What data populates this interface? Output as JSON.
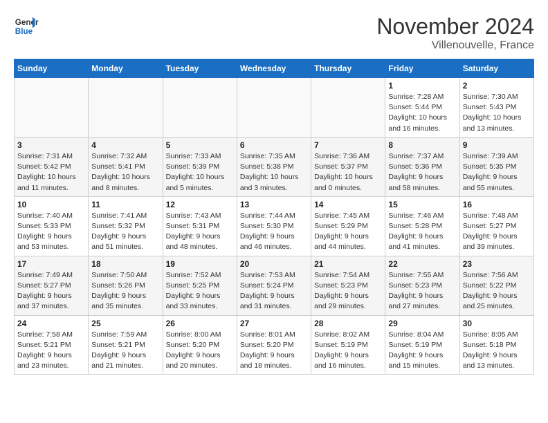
{
  "header": {
    "logo_line1": "General",
    "logo_line2": "Blue",
    "month": "November 2024",
    "location": "Villenouvelle, France"
  },
  "weekdays": [
    "Sunday",
    "Monday",
    "Tuesday",
    "Wednesday",
    "Thursday",
    "Friday",
    "Saturday"
  ],
  "weeks": [
    [
      {
        "day": "",
        "info": ""
      },
      {
        "day": "",
        "info": ""
      },
      {
        "day": "",
        "info": ""
      },
      {
        "day": "",
        "info": ""
      },
      {
        "day": "",
        "info": ""
      },
      {
        "day": "1",
        "info": "Sunrise: 7:28 AM\nSunset: 5:44 PM\nDaylight: 10 hours and 16 minutes."
      },
      {
        "day": "2",
        "info": "Sunrise: 7:30 AM\nSunset: 5:43 PM\nDaylight: 10 hours and 13 minutes."
      }
    ],
    [
      {
        "day": "3",
        "info": "Sunrise: 7:31 AM\nSunset: 5:42 PM\nDaylight: 10 hours and 11 minutes."
      },
      {
        "day": "4",
        "info": "Sunrise: 7:32 AM\nSunset: 5:41 PM\nDaylight: 10 hours and 8 minutes."
      },
      {
        "day": "5",
        "info": "Sunrise: 7:33 AM\nSunset: 5:39 PM\nDaylight: 10 hours and 5 minutes."
      },
      {
        "day": "6",
        "info": "Sunrise: 7:35 AM\nSunset: 5:38 PM\nDaylight: 10 hours and 3 minutes."
      },
      {
        "day": "7",
        "info": "Sunrise: 7:36 AM\nSunset: 5:37 PM\nDaylight: 10 hours and 0 minutes."
      },
      {
        "day": "8",
        "info": "Sunrise: 7:37 AM\nSunset: 5:36 PM\nDaylight: 9 hours and 58 minutes."
      },
      {
        "day": "9",
        "info": "Sunrise: 7:39 AM\nSunset: 5:35 PM\nDaylight: 9 hours and 55 minutes."
      }
    ],
    [
      {
        "day": "10",
        "info": "Sunrise: 7:40 AM\nSunset: 5:33 PM\nDaylight: 9 hours and 53 minutes."
      },
      {
        "day": "11",
        "info": "Sunrise: 7:41 AM\nSunset: 5:32 PM\nDaylight: 9 hours and 51 minutes."
      },
      {
        "day": "12",
        "info": "Sunrise: 7:43 AM\nSunset: 5:31 PM\nDaylight: 9 hours and 48 minutes."
      },
      {
        "day": "13",
        "info": "Sunrise: 7:44 AM\nSunset: 5:30 PM\nDaylight: 9 hours and 46 minutes."
      },
      {
        "day": "14",
        "info": "Sunrise: 7:45 AM\nSunset: 5:29 PM\nDaylight: 9 hours and 44 minutes."
      },
      {
        "day": "15",
        "info": "Sunrise: 7:46 AM\nSunset: 5:28 PM\nDaylight: 9 hours and 41 minutes."
      },
      {
        "day": "16",
        "info": "Sunrise: 7:48 AM\nSunset: 5:27 PM\nDaylight: 9 hours and 39 minutes."
      }
    ],
    [
      {
        "day": "17",
        "info": "Sunrise: 7:49 AM\nSunset: 5:27 PM\nDaylight: 9 hours and 37 minutes."
      },
      {
        "day": "18",
        "info": "Sunrise: 7:50 AM\nSunset: 5:26 PM\nDaylight: 9 hours and 35 minutes."
      },
      {
        "day": "19",
        "info": "Sunrise: 7:52 AM\nSunset: 5:25 PM\nDaylight: 9 hours and 33 minutes."
      },
      {
        "day": "20",
        "info": "Sunrise: 7:53 AM\nSunset: 5:24 PM\nDaylight: 9 hours and 31 minutes."
      },
      {
        "day": "21",
        "info": "Sunrise: 7:54 AM\nSunset: 5:23 PM\nDaylight: 9 hours and 29 minutes."
      },
      {
        "day": "22",
        "info": "Sunrise: 7:55 AM\nSunset: 5:23 PM\nDaylight: 9 hours and 27 minutes."
      },
      {
        "day": "23",
        "info": "Sunrise: 7:56 AM\nSunset: 5:22 PM\nDaylight: 9 hours and 25 minutes."
      }
    ],
    [
      {
        "day": "24",
        "info": "Sunrise: 7:58 AM\nSunset: 5:21 PM\nDaylight: 9 hours and 23 minutes."
      },
      {
        "day": "25",
        "info": "Sunrise: 7:59 AM\nSunset: 5:21 PM\nDaylight: 9 hours and 21 minutes."
      },
      {
        "day": "26",
        "info": "Sunrise: 8:00 AM\nSunset: 5:20 PM\nDaylight: 9 hours and 20 minutes."
      },
      {
        "day": "27",
        "info": "Sunrise: 8:01 AM\nSunset: 5:20 PM\nDaylight: 9 hours and 18 minutes."
      },
      {
        "day": "28",
        "info": "Sunrise: 8:02 AM\nSunset: 5:19 PM\nDaylight: 9 hours and 16 minutes."
      },
      {
        "day": "29",
        "info": "Sunrise: 8:04 AM\nSunset: 5:19 PM\nDaylight: 9 hours and 15 minutes."
      },
      {
        "day": "30",
        "info": "Sunrise: 8:05 AM\nSunset: 5:18 PM\nDaylight: 9 hours and 13 minutes."
      }
    ]
  ]
}
